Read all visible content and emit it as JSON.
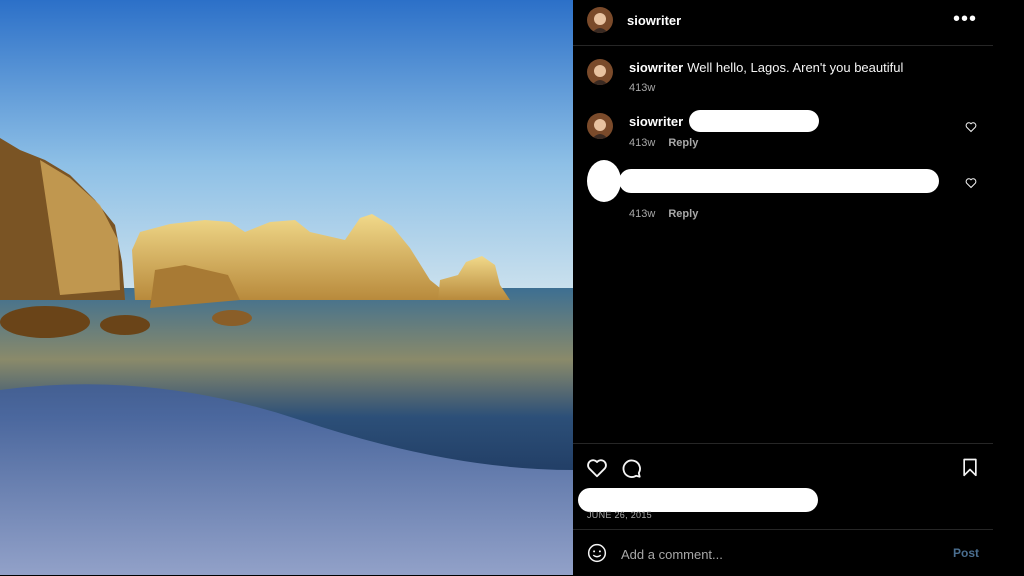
{
  "post": {
    "username": "siowriter",
    "more_icon": "more-horizontal-icon",
    "photo_icon": "beach-photo"
  },
  "comments": [
    {
      "username": "siowriter",
      "text": "Well hello, Lagos. Aren't you beautiful",
      "time": "413w"
    },
    {
      "username": "siowriter",
      "text": "",
      "time": "413w",
      "reply": "Reply",
      "redacted": true
    },
    {
      "username": "",
      "text": "",
      "time": "413w",
      "reply": "Reply",
      "redacted": true
    }
  ],
  "actions": {
    "like_icon": "heart-icon",
    "comment_icon": "comment-bubble-icon",
    "save_icon": "bookmark-icon"
  },
  "date": "JUNE 26, 2015",
  "add_comment": {
    "placeholder": "Add a comment...",
    "post_label": "Post",
    "emoji_icon": "emoji-icon"
  },
  "colors": {
    "background": "#000000",
    "text": "#f5f5f5",
    "muted": "#a8a8a8",
    "post": "#4a6e8f",
    "divider": "#262626"
  }
}
